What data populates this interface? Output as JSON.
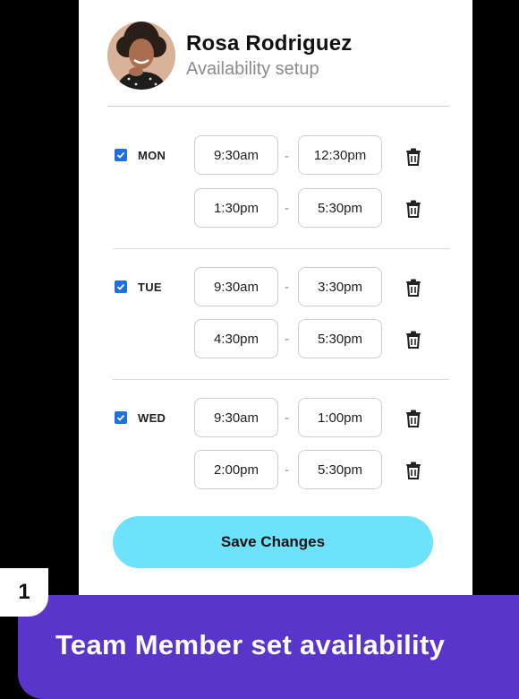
{
  "profile": {
    "name": "Rosa Rodriguez",
    "subtitle": "Availability setup"
  },
  "days": [
    {
      "label": "MON",
      "checked": true,
      "slots": [
        {
          "start": "9:30am",
          "end": "12:30pm"
        },
        {
          "start": "1:30pm",
          "end": "5:30pm"
        }
      ]
    },
    {
      "label": "TUE",
      "checked": true,
      "slots": [
        {
          "start": "9:30am",
          "end": "3:30pm"
        },
        {
          "start": "4:30pm",
          "end": "5:30pm"
        }
      ]
    },
    {
      "label": "WED",
      "checked": true,
      "slots": [
        {
          "start": "9:30am",
          "end": "1:00pm"
        },
        {
          "start": "2:00pm",
          "end": "5:30pm"
        }
      ]
    }
  ],
  "separator": "-",
  "save_label": "Save Changes",
  "caption": {
    "step": "1",
    "text": "Team Member set availability"
  },
  "colors": {
    "accent_button": "#6ce3fb",
    "checkbox": "#1e6fe0",
    "caption_bar": "#5a35c9"
  },
  "icons": {
    "delete": "trash-icon",
    "check": "check-icon"
  }
}
